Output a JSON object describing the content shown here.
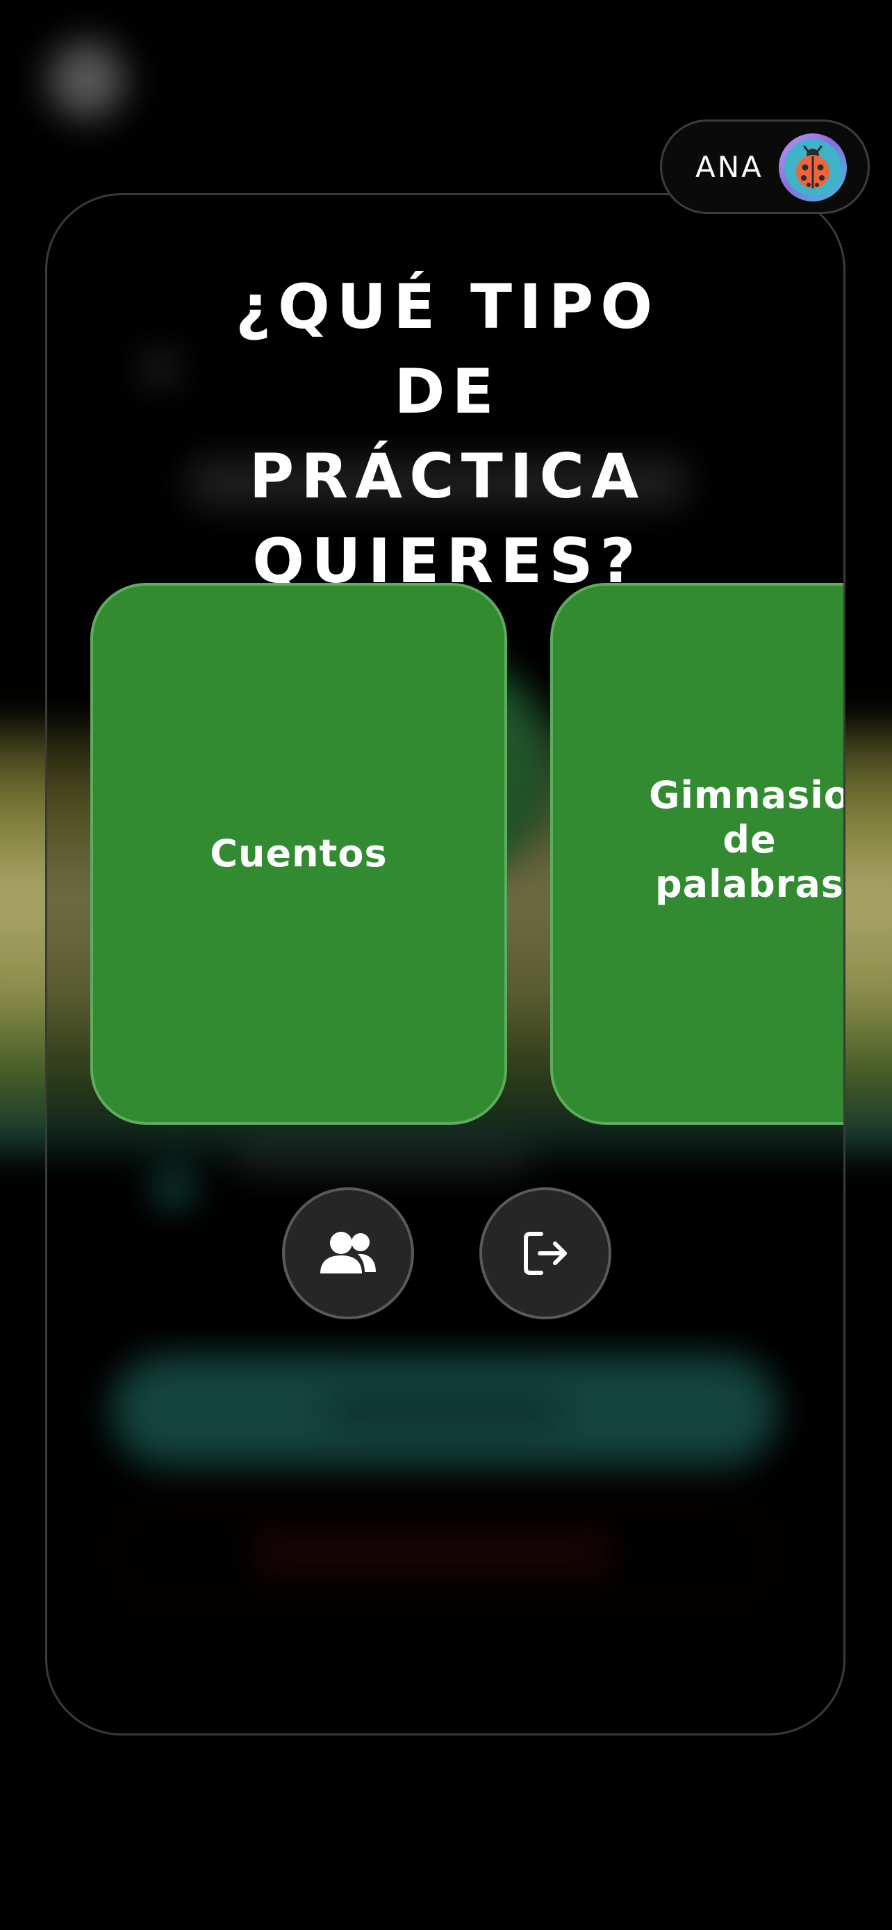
{
  "page": {
    "title": "¿QUÉ TIPO DE PRÁCTICA QUIERES?"
  },
  "practice_cards": [
    {
      "label": "Cuentos",
      "color": "#328a31"
    },
    {
      "label": "Gimnasio de palabras",
      "color": "#328a31"
    }
  ],
  "actions": {
    "users_icon": "users-icon",
    "logout_icon": "logout-icon"
  },
  "user": {
    "name": "ANA",
    "avatar_icon": "ladybug-icon"
  },
  "colors": {
    "background": "#000000",
    "card_green": "#328a31",
    "card_border": "#5dad5f",
    "panel_border": "#3a3a3a",
    "text": "#ffffff"
  }
}
